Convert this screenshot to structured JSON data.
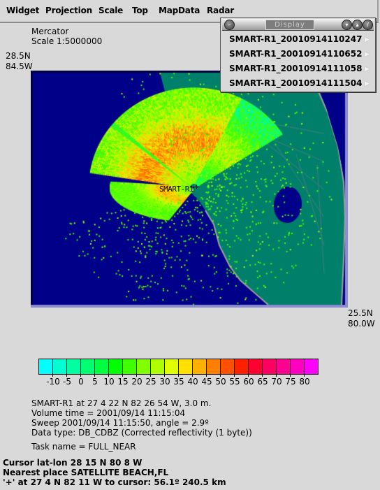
{
  "menubar": {
    "items": [
      "Widget",
      "Projection",
      "Scale",
      "Top",
      "MapData",
      "Radar"
    ]
  },
  "map_info": {
    "projection": "Mercator",
    "scale": "Scale 1:5000000",
    "top_left_lat": "28.5N",
    "top_left_lon": "84.5W",
    "bottom_right_lat": "25.5N",
    "bottom_right_lon": "80.0W",
    "radar_label": "SMART-R1",
    "colors": {
      "ocean": "#000088",
      "land": "#00806a",
      "frame_light": "#8c8cd0",
      "frame_dark": "#000040",
      "coast": "#a0a0a0"
    }
  },
  "popup": {
    "title": "Display",
    "items": [
      "SMART-R1_20010914110247",
      "SMART-R1_20010914110652",
      "SMART-R1_20010914111058",
      "SMART-R1_20010914111504"
    ]
  },
  "colorbar": {
    "colors": [
      "#00ffff",
      "#00ffd0",
      "#00ffa0",
      "#00ff70",
      "#00ff40",
      "#00ff00",
      "#40ff00",
      "#80ff00",
      "#b0ff00",
      "#e0ff00",
      "#ffe000",
      "#ffb000",
      "#ff8000",
      "#ff5000",
      "#ff2000",
      "#ff0030",
      "#ff0060",
      "#ff0090",
      "#ff00c0",
      "#ff00ff"
    ],
    "labels": [
      "-10",
      "-5",
      "0",
      "5",
      "10",
      "15",
      "20",
      "25",
      "30",
      "35",
      "40",
      "45",
      "50",
      "55",
      "60",
      "65",
      "70",
      "75",
      "80"
    ]
  },
  "radar_meta": {
    "location": "SMART-R1 at 27 4 22 N 82 26 54 W, 3.0 m.",
    "volume_time": "Volume time = 2001/09/14 11:15:04",
    "sweep": "Sweep 2001/09/14 11:15:50, angle = 2.9º",
    "data_type": "Data type: DB_CDBZ (Corrected reflectivity (1 byte))",
    "task": "Task name = FULL_NEAR"
  },
  "cursor": {
    "lat_lon": "Cursor lat-lon 28 15 N  80  8 W",
    "nearest": "Nearest place SATELLITE BEACH,FL",
    "range": "'+' at 27 4 N 82 11 W to cursor:  56.1º   240.5 km"
  }
}
